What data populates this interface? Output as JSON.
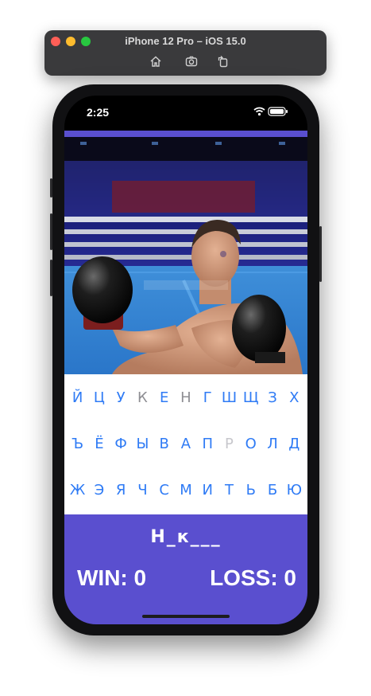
{
  "simulator": {
    "title": "iPhone 12 Pro – iOS 15.0",
    "tools": [
      "home-icon",
      "screenshot-icon",
      "rotate-icon"
    ]
  },
  "status_bar": {
    "time": "2:25",
    "icons": [
      "wifi-icon",
      "battery-icon"
    ]
  },
  "hero_image": {
    "subject": "boxer with black gloves in boxing ring"
  },
  "keyboard": {
    "rows": [
      [
        "Й",
        "Ц",
        "У",
        "К",
        "Е",
        "Н",
        "Г",
        "Ш",
        "Щ",
        "З",
        "Х"
      ],
      [
        "Ъ",
        "Ё",
        "Ф",
        "Ы",
        "В",
        "А",
        "П",
        "Р",
        "О",
        "Л",
        "Д"
      ],
      [
        "Ж",
        "Э",
        "Я",
        "Ч",
        "С",
        "М",
        "И",
        "Т",
        "Ь",
        "Б",
        "Ю"
      ]
    ],
    "used_letters": [
      "К",
      "Н"
    ],
    "dim_letters": [
      "Р"
    ]
  },
  "game": {
    "word": "Н_к___",
    "win_label": "WIN: 0",
    "loss_label": "LOSS: 0"
  },
  "colors": {
    "accent": "#5a4fcf",
    "key_active": "#2f7bf5",
    "key_used": "#8e8e93",
    "key_dim": "#c7c7cc"
  }
}
